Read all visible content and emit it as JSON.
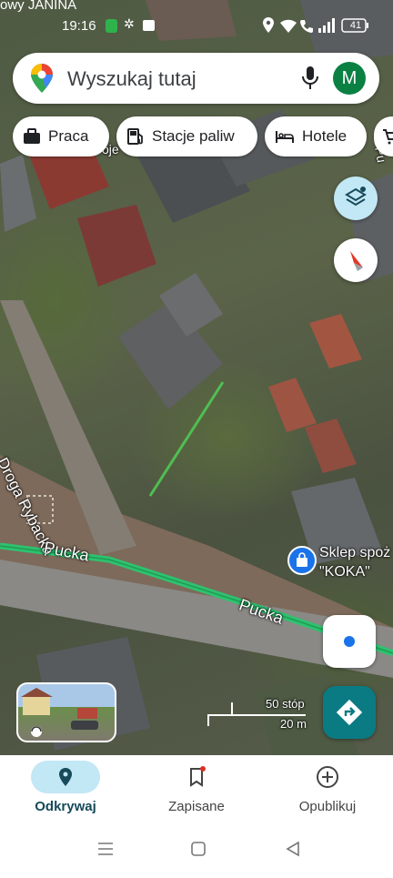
{
  "status_bar": {
    "carrier_text": "owy JANINA",
    "time": "19:16",
    "battery": "41"
  },
  "search": {
    "placeholder": "Wyszukaj tutaj",
    "avatar_letter": "M"
  },
  "chips": [
    {
      "label": "Praca",
      "icon": "briefcase-icon"
    },
    {
      "label": "Stacje paliw",
      "icon": "gas-station-icon"
    },
    {
      "label": "Hotele",
      "icon": "bed-icon"
    }
  ],
  "map": {
    "street_labels": [
      "Droga Rybacka",
      "Pucka",
      "Pucka"
    ],
    "poi": {
      "name_line1": "Sklep spoż",
      "name_line2": "\"KOKA\""
    },
    "partial_labels": [
      "oje",
      "Pu"
    ],
    "scale": {
      "imperial": "50 stóp",
      "metric": "20 m"
    }
  },
  "bottom_nav": [
    {
      "label": "Odkrywaj",
      "icon": "location-pin-icon",
      "active": true
    },
    {
      "label": "Zapisane",
      "icon": "bookmark-icon",
      "active": false
    },
    {
      "label": "Opublikuj",
      "icon": "add-circle-icon",
      "active": false
    }
  ],
  "colors": {
    "accent_green": "#0b8043",
    "route_green": "#2ec26f",
    "blue": "#1a73e8",
    "teal_fab": "#0a7b83"
  }
}
